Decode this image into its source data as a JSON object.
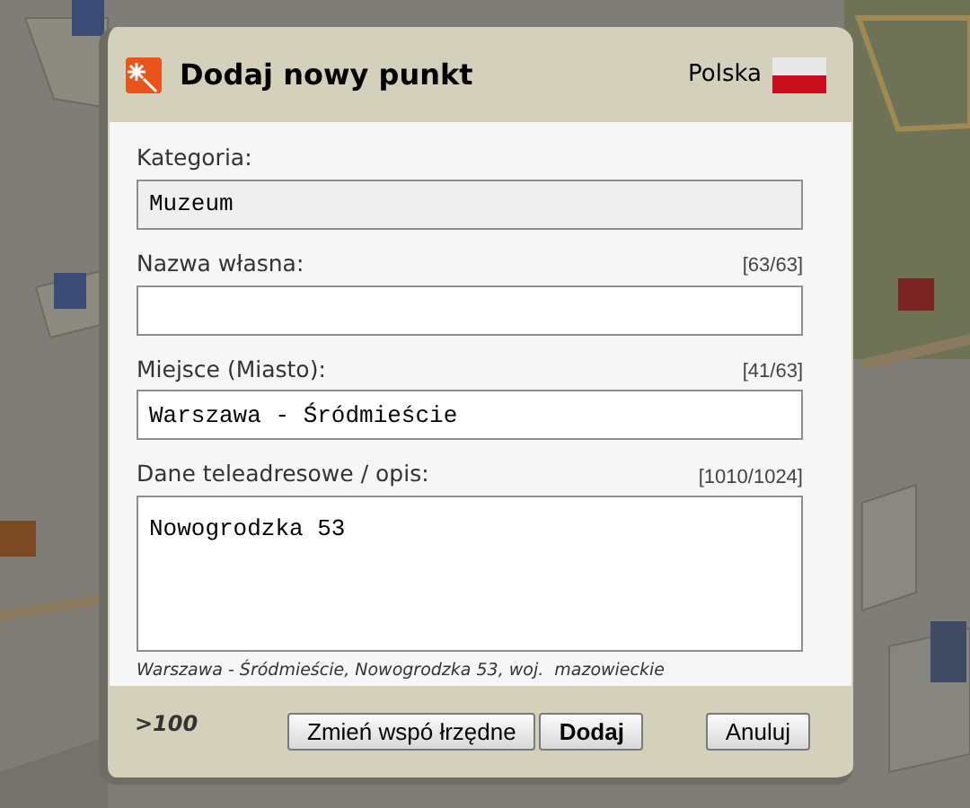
{
  "dialog": {
    "title": "Dodaj nowy punkt",
    "country": "Polska"
  },
  "fields": [
    {
      "kind": "input",
      "label": "Kategoria:",
      "value": "Muzeum",
      "disabled": true
    },
    {
      "kind": "input",
      "label": "Nazwa własna:",
      "counter": "[63/63]",
      "disabled": false
    },
    {
      "kind": "input",
      "label": "Miejsce (Miasto):",
      "counter": "[41/63]",
      "value": "Warszawa - Śródmieście",
      "disabled": false
    },
    {
      "kind": "textarea",
      "label": "Dane teleadresowe / opis:",
      "counter": "[1010/1024]",
      "value": "Nowogrodzka 53",
      "disabled": false
    }
  ],
  "address_summary": "Warszawa - Śródmieście, Nowogrodzka 53, woj.  mazowieckie",
  "footer_note": ">100",
  "buttons": [
    {
      "label": "Zmień wspó łrzędne",
      "default": false
    },
    {
      "label": "Dodaj",
      "default": true
    },
    {
      "label": "Anuluj",
      "default": false
    }
  ]
}
